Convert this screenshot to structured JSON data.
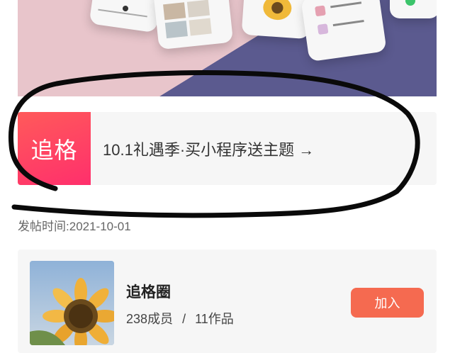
{
  "banner": {
    "logo_text": "追格",
    "promo_text": "10.1礼遇季·买小程序送主题 →"
  },
  "post": {
    "time_label": "发帖时间:",
    "time_value": "2021-10-01"
  },
  "group": {
    "name": "追格圈",
    "members": "238成员",
    "separator": "/",
    "works": "11作品",
    "join_label": "加入"
  },
  "colors": {
    "accent": "#f56a50",
    "logo_gradient_start": "#ff5a5a",
    "logo_gradient_end": "#ff2f6c",
    "hero_pink": "#e9c6cb",
    "hero_navy": "#5b5a8f"
  }
}
